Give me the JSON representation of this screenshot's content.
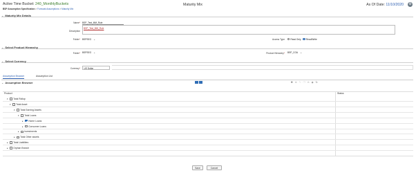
{
  "header": {
    "title_prefix": "Active Time Bucket:",
    "bucket_name": "240_MonthlyBuckets",
    "breadcrumb_root": "BSP Assumption Specification",
    "breadcrumb_sep1": " > ",
    "breadcrumb_mid": "Forecast Assumptions",
    "breadcrumb_sep2": " > ",
    "breadcrumb_leaf": "Maturity Mix",
    "page_title": "Maturity Mix",
    "as_of_label": "As Of Date:",
    "as_of_value": "11/10/2020",
    "gear_icon": "gear-icon"
  },
  "sections": {
    "details": "Maturity Mix Details",
    "hierarchy": "Select Product Hierarchy",
    "currency": "Select Currency",
    "browser": "Assumption Browser"
  },
  "details": {
    "name_label": "Name",
    "name_value": "BSP_Test_MM_Rule",
    "description_label": "Description",
    "description_value": "BSP_Test_MM_Rule",
    "folder_label": "Folder",
    "folder_value": "BSPSEG",
    "access_type_label": "Access Type",
    "access_readonly": "Read Only",
    "access_readwrite": "Read/Write"
  },
  "hierarchy": {
    "folder_label": "Folder",
    "folder_value": "BSPSEG",
    "product_hierarchy_label": "Product Hierarchy",
    "product_hierarchy_value": "BSP_COA"
  },
  "currency": {
    "label": "Currency",
    "value": "US Dollar"
  },
  "tabs": [
    {
      "label": "Assumption Browser",
      "active": true
    },
    {
      "label": "Assumption List",
      "active": false
    }
  ],
  "grid": {
    "col_product": "Product",
    "col_status": "Status",
    "rows": [
      {
        "label": "Total Rollup",
        "toggle": "▾",
        "checked": false
      },
      {
        "label": "Total Asset",
        "toggle": "▾",
        "checked": false
      },
      {
        "label": "Total Earning Assets",
        "toggle": "▾",
        "checked": false
      },
      {
        "label": "Total Loans",
        "toggle": "▾",
        "checked": false
      },
      {
        "label": "Home Loans",
        "toggle": "▸",
        "checked": true
      },
      {
        "label": "Consumer Loans",
        "toggle": "▸",
        "checked": false
      },
      {
        "label": "Investments",
        "toggle": "▸",
        "checked": false
      },
      {
        "label": "Total Other assets",
        "toggle": "▸",
        "checked": false
      },
      {
        "label": "Total Liabilities",
        "toggle": "▸",
        "checked": false
      },
      {
        "label": "Orphan Branch",
        "toggle": "▸",
        "checked": false
      }
    ]
  },
  "footer": {
    "save_label": "Save",
    "cancel_label": "Cancel"
  }
}
